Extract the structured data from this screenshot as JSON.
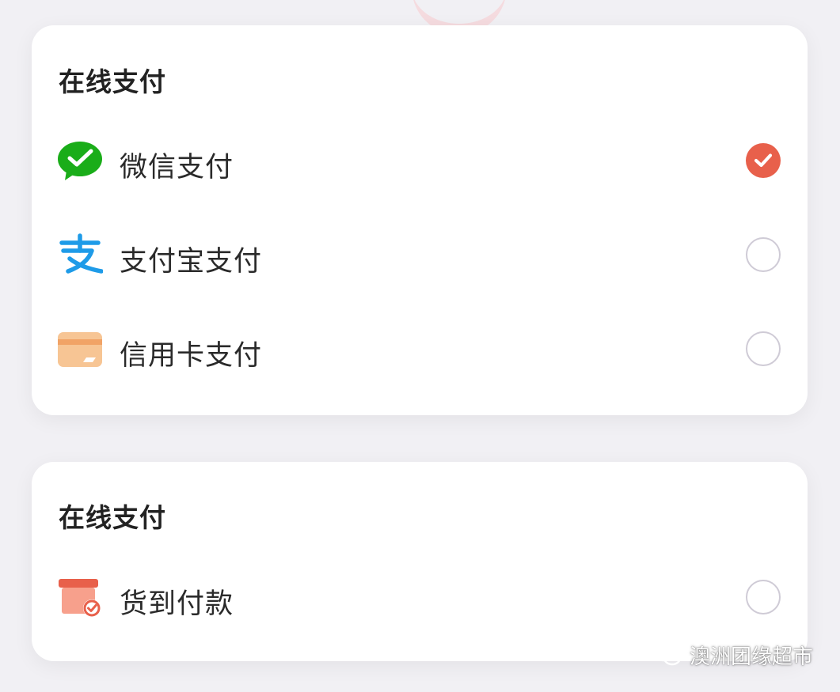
{
  "sections": [
    {
      "title": "在线支付",
      "options": [
        {
          "label": "微信支付",
          "icon": "wechat-pay-icon",
          "checked": true
        },
        {
          "label": "支付宝支付",
          "icon": "alipay-icon",
          "checked": false
        },
        {
          "label": "信用卡支付",
          "icon": "credit-card-icon",
          "checked": false
        }
      ]
    },
    {
      "title": "在线支付",
      "options": [
        {
          "label": "货到付款",
          "icon": "cash-on-delivery-icon",
          "checked": false
        }
      ]
    }
  ],
  "watermark": {
    "text": "澳洲团缘超市",
    "icon": "wechat-logo-icon"
  },
  "colors": {
    "accent": "#e8604b",
    "wechat_green": "#1aad19",
    "alipay_blue": "#1e9be8",
    "card_orange": "#f7b77a",
    "delivery_red": "#ea6a55",
    "radio_border": "#cfcbd6"
  }
}
